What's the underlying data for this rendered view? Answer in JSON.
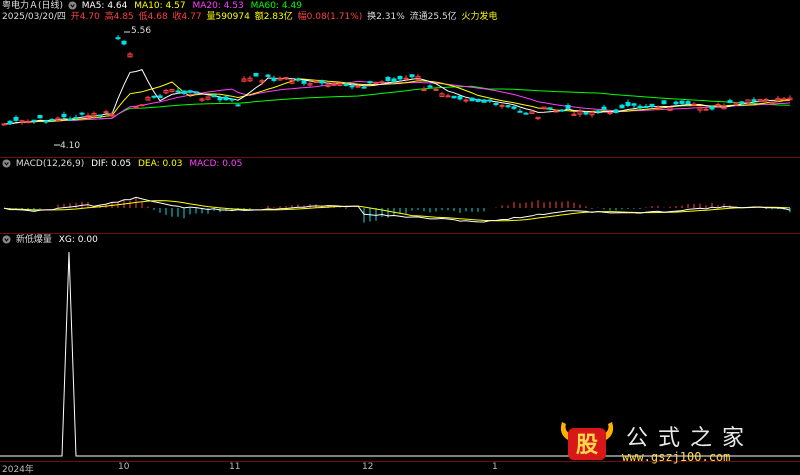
{
  "colors": {
    "up": "#ff4040",
    "down": "#00e0e0",
    "ma5": "#ffffff",
    "ma10": "#ffff00",
    "ma20": "#ff40ff",
    "ma60": "#00ff00",
    "sep": "#6b1010",
    "grid": "#6b1010"
  },
  "header": {
    "stock_name": "粤电力Ａ(日线)",
    "ma5_label": "MA5: 4.64",
    "ma10_label": "MA10: 4.57",
    "ma20_label": "MA20: 4.53",
    "ma60_label": "MA60: 4.49"
  },
  "info": {
    "date": "2025/03/20/四",
    "open": "开4.70",
    "high": "高4.85",
    "low": "低4.68",
    "close": "收4.77",
    "volume": "量590974",
    "amount": "额2.83亿",
    "change": "幅0.08(1.71%)",
    "turnover": "换2.31%",
    "float": "流通25.5亿",
    "concept": "火力发电"
  },
  "price_marks": {
    "high": "5.56",
    "low": "4.10"
  },
  "macd": {
    "title": "MACD(12,26,9)",
    "dif": "DIF: 0.05",
    "dea": "DEA: 0.03",
    "macd": "MACD: 0.05"
  },
  "indicator": {
    "title": "新低爆量",
    "xg": "XG: 0.00"
  },
  "xaxis": {
    "labels": [
      "2024年",
      "10",
      "11",
      "12",
      "1"
    ]
  },
  "watermark": {
    "logo_text": "股",
    "name": "公式之家",
    "url": "www.gszj100.com"
  }
}
